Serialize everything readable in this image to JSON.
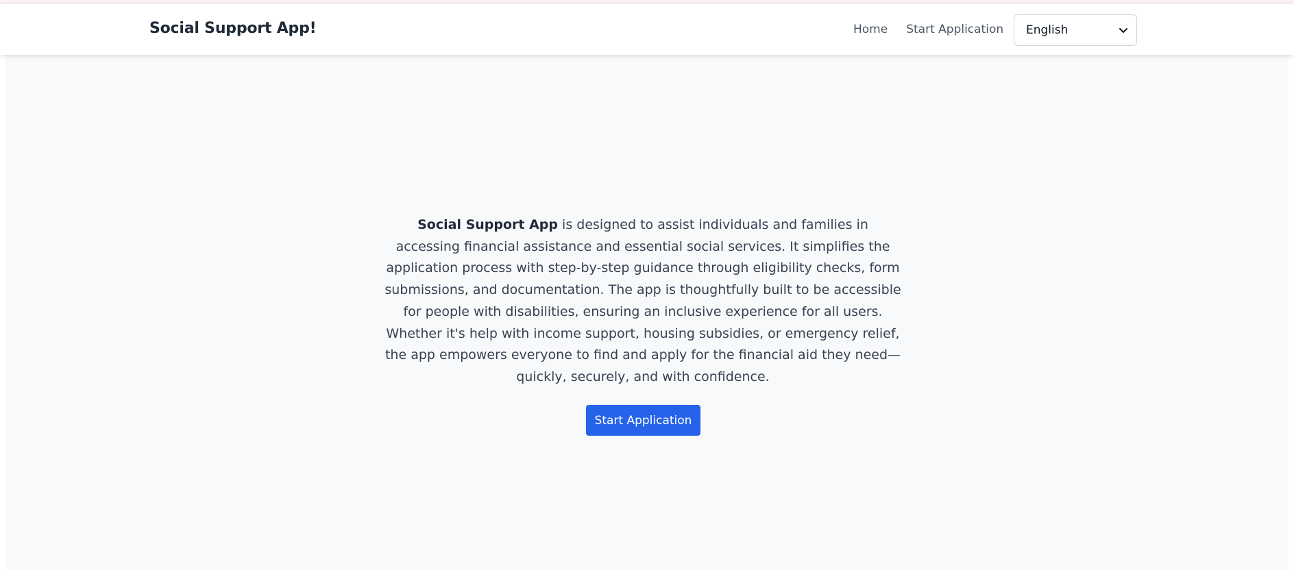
{
  "header": {
    "brand": "Social Support App!",
    "nav": [
      {
        "label": "Home"
      },
      {
        "label": "Start Application"
      }
    ],
    "language_select": {
      "value": "English",
      "icon": "chevron-down-icon"
    }
  },
  "main": {
    "intro_app_name": "Social Support App",
    "intro_text": " is designed to assist individuals and families in accessing financial assistance and essential social services. It simplifies the application process with step-by-step guidance through eligibility checks, form submissions, and documentation. The app is thoughtfully built to be accessible for people with disabilities, ensuring an inclusive experience for all users. Whether it's help with income support, housing subsidies, or emergency relief, the app empowers everyone to find and apply for the financial aid they need—quickly, securely, and with confidence.",
    "cta_label": "Start Application"
  },
  "colors": {
    "primary": "#2563eb",
    "page_background": "#f8f9fb",
    "header_background": "#ffffff",
    "text": "#374151",
    "brand_text": "#1f2937"
  }
}
